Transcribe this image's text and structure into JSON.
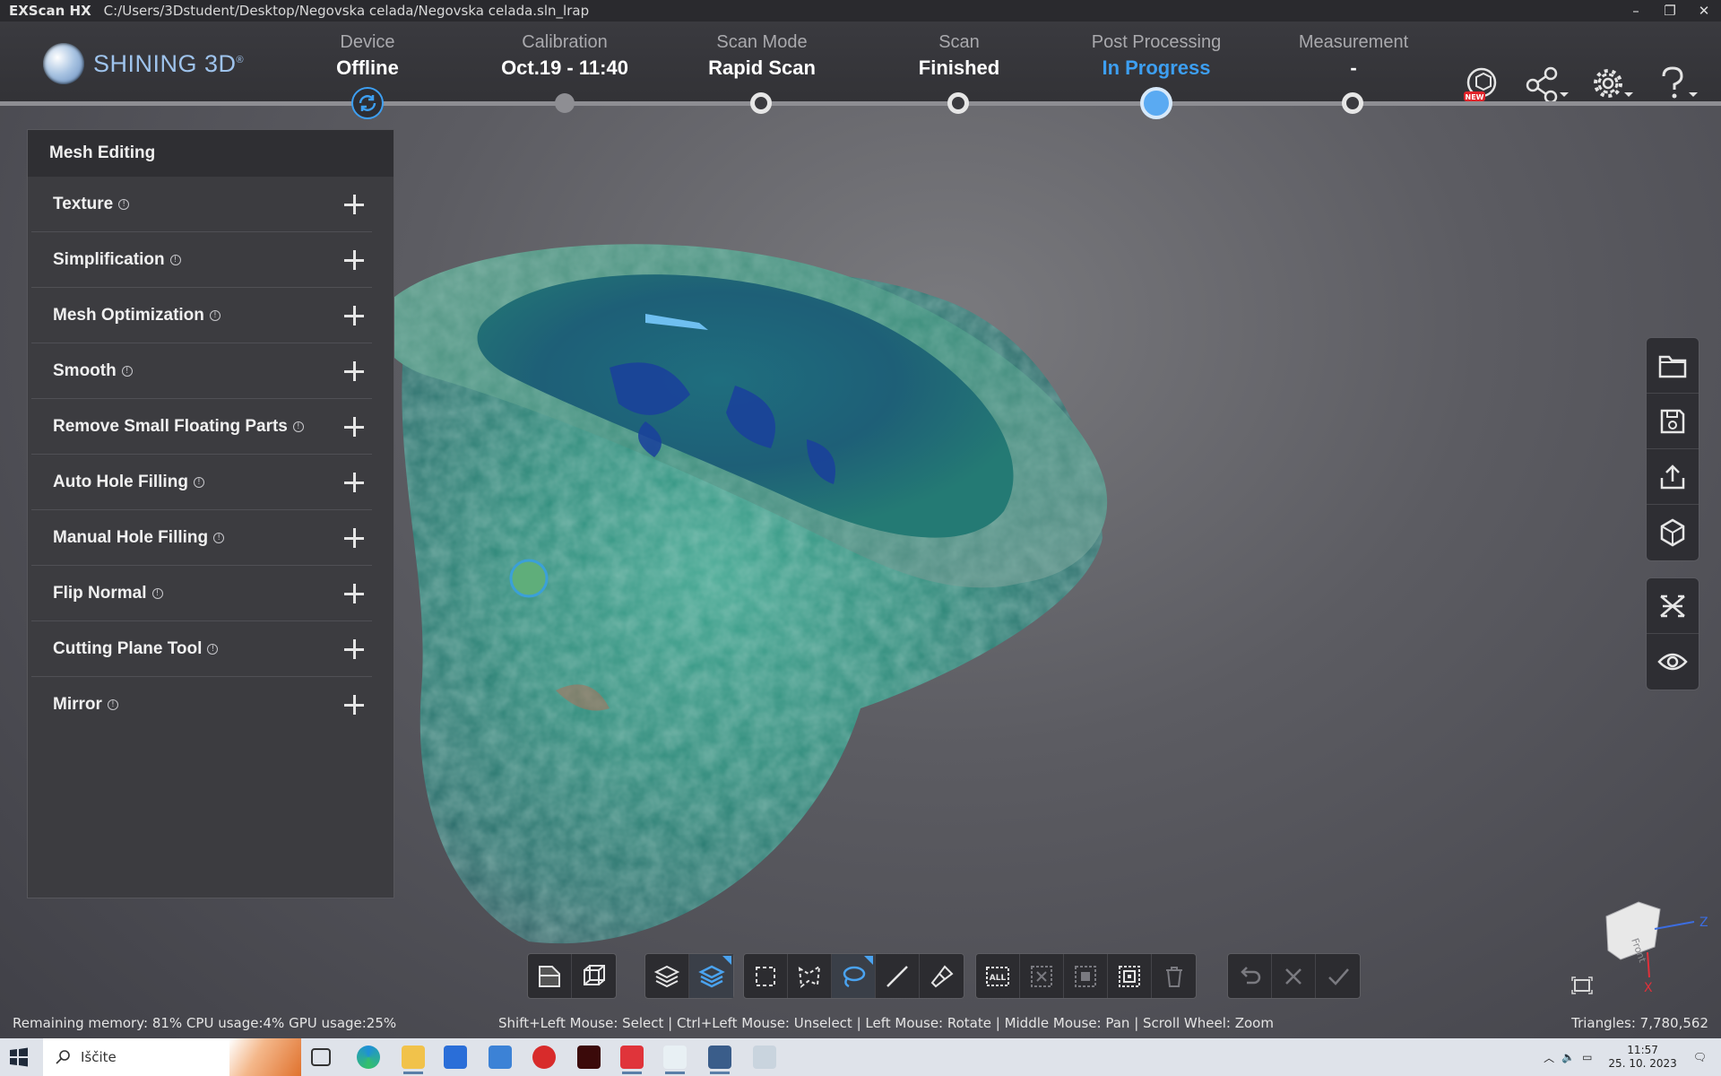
{
  "window": {
    "app_name": "EXScan HX",
    "path": "C:/Users/3Dstudent/Desktop/Negovska celada/Negovska celada.sln_lrap",
    "controls": [
      "–",
      "❐",
      "✕"
    ]
  },
  "header": {
    "brand": "SHINING 3D",
    "brand_mark": "®",
    "steps": [
      {
        "label": "Device",
        "value": "Offline"
      },
      {
        "label": "Calibration",
        "value": "Oct.19 - 11:40"
      },
      {
        "label": "Scan Mode",
        "value": "Rapid Scan"
      },
      {
        "label": "Scan",
        "value": "Finished"
      },
      {
        "label": "Post Processing",
        "value": "In Progress"
      },
      {
        "label": "Measurement",
        "value": "-"
      }
    ],
    "icons": [
      "cloud-new-icon",
      "share-icon",
      "settings-icon",
      "help-icon"
    ],
    "new_badge": "NEW",
    "accent_color": "#3d9ff2"
  },
  "panel": {
    "title": "Mesh Editing",
    "items": [
      {
        "label": "Texture"
      },
      {
        "label": "Simplification"
      },
      {
        "label": "Mesh Optimization"
      },
      {
        "label": "Smooth"
      },
      {
        "label": "Remove Small Floating Parts"
      },
      {
        "label": "Auto Hole Filling"
      },
      {
        "label": "Manual Hole Filling"
      },
      {
        "label": "Flip Normal"
      },
      {
        "label": "Cutting Plane Tool"
      },
      {
        "label": "Mirror"
      }
    ],
    "info_glyph": "!"
  },
  "right_toolbar": {
    "group1": [
      "open-folder-icon",
      "save-icon",
      "export-icon",
      "model-cube-icon"
    ],
    "group2": [
      "align-icon",
      "visibility-eye-icon"
    ]
  },
  "bottom_toolbar": {
    "view_group": [
      "view-mode-icon",
      "wireframe-icon"
    ],
    "layer_group": [
      "select-visible-icon",
      "select-through-icon"
    ],
    "selection_group": [
      "rect-select-icon",
      "polygon-select-icon",
      "lasso-select-icon",
      "line-select-icon",
      "brush-select-icon"
    ],
    "edit_group": [
      "select-all-icon",
      "deselect-icon",
      "invert-select-icon",
      "select-connected-icon",
      "delete-icon"
    ],
    "confirm_group": [
      "undo-icon",
      "cancel-icon",
      "apply-icon"
    ],
    "select_all_text": "ALL"
  },
  "viewport": {
    "axis": {
      "z": "Z",
      "x": "X",
      "cube_face": "Front"
    }
  },
  "status": {
    "left": "Remaining memory: 81% CPU usage:4%  GPU usage:25%",
    "mid": "Shift+Left Mouse: Select | Ctrl+Left Mouse: Unselect | Left Mouse: Rotate | Middle Mouse: Pan | Scroll Wheel: Zoom",
    "right": "Triangles: 7,780,562"
  },
  "taskbar": {
    "search_placeholder": "Iščite",
    "time": "11:57",
    "date": "25. 10. 2023"
  }
}
